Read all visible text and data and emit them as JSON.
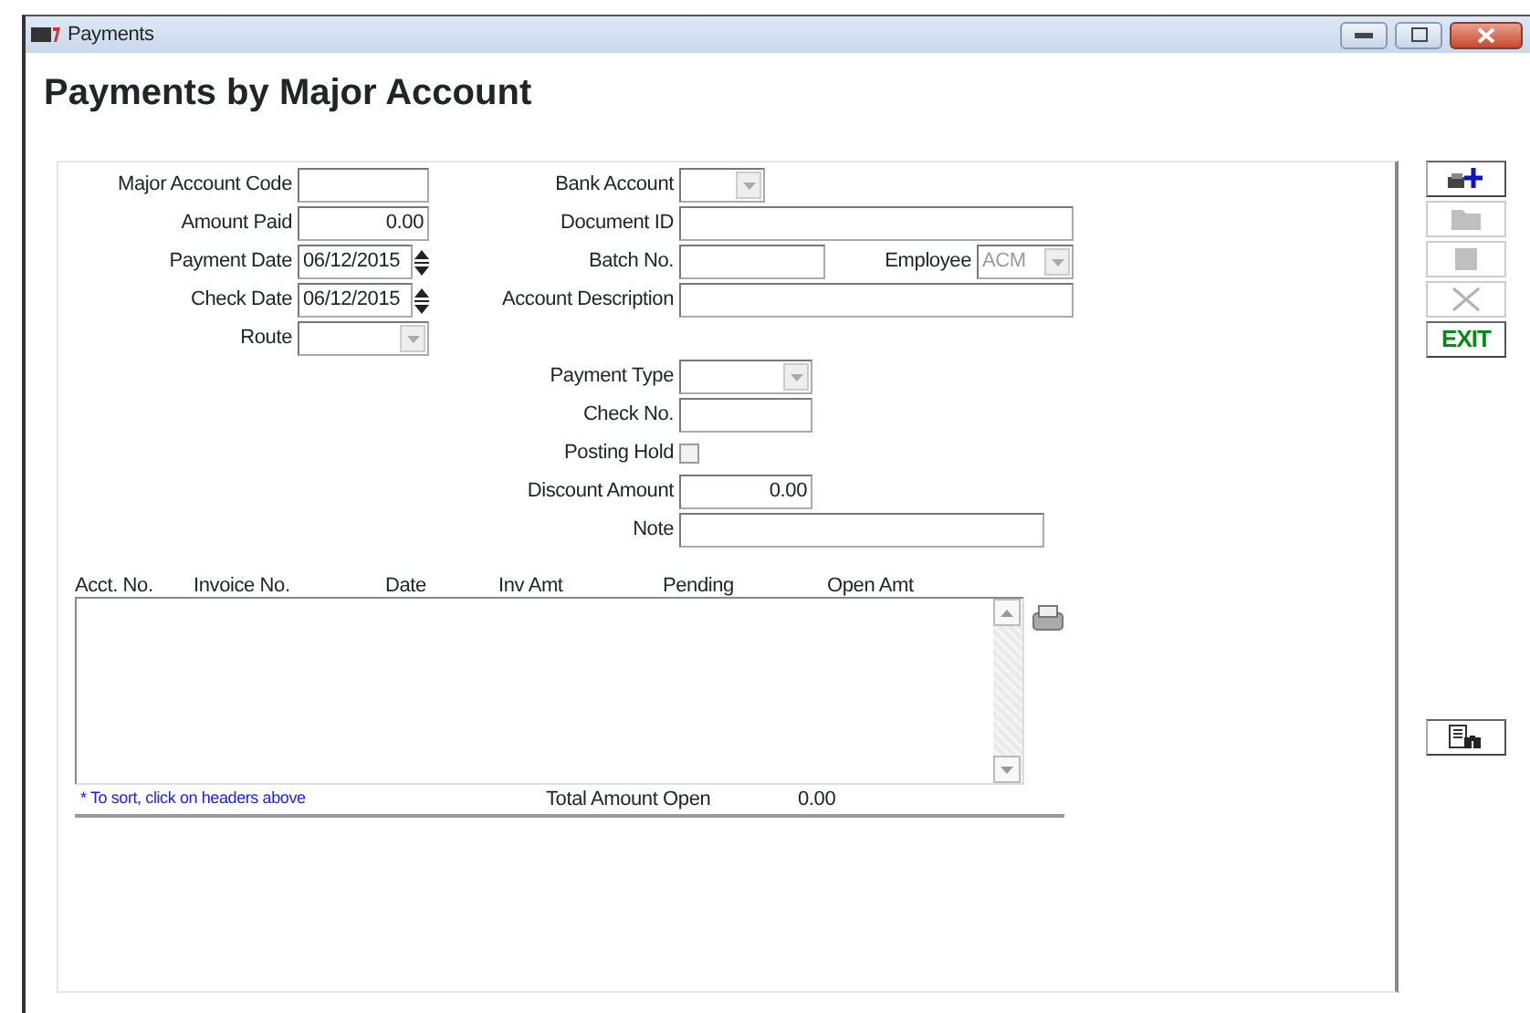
{
  "window": {
    "title": "Payments"
  },
  "heading": "Payments by Major Account",
  "left_fields": [
    {
      "label": "Major Account Code",
      "kind": "text"
    },
    {
      "label": "Amount Paid",
      "kind": "number",
      "value": "0.00"
    },
    {
      "label": "Payment Date",
      "kind": "spin",
      "value": "06/12/2015"
    },
    {
      "label": "Check Date",
      "kind": "spin",
      "value": "06/12/2015"
    },
    {
      "label": "Route",
      "kind": "combo"
    }
  ],
  "right_fields": [
    {
      "label": "Bank Account",
      "kind": "combo"
    },
    {
      "label": "Document ID",
      "kind": "text"
    },
    {
      "label": "Batch No.",
      "kind": "text",
      "extra": {
        "label": "Employee",
        "value": "ACM",
        "disabled": true
      }
    },
    {
      "label": "Account Description",
      "kind": "text"
    },
    {
      "kind": "blank"
    },
    {
      "label": "Payment Type",
      "kind": "combo"
    },
    {
      "label": "Check No.",
      "kind": "short"
    },
    {
      "label": "Posting Hold",
      "kind": "checkbox",
      "checked": false
    },
    {
      "label": "Discount Amount",
      "kind": "number",
      "value": "0.00"
    },
    {
      "label": "Note",
      "kind": "wide"
    }
  ],
  "table": {
    "columns": [
      "Acct. No.",
      "Invoice No.",
      "Date",
      "Inv Amt",
      "Pending",
      "Open Amt"
    ]
  },
  "sort_hint": "* To sort, click on headers above",
  "total": {
    "label": "Total Amount Open",
    "value": "0.00"
  },
  "toolbar": [
    {
      "kind": "new",
      "disabled": false
    },
    {
      "kind": "open",
      "disabled": true
    },
    {
      "kind": "stop",
      "disabled": true
    },
    {
      "kind": "delete",
      "disabled": true
    },
    {
      "kind": "exit",
      "label": "EXIT",
      "disabled": false
    }
  ]
}
